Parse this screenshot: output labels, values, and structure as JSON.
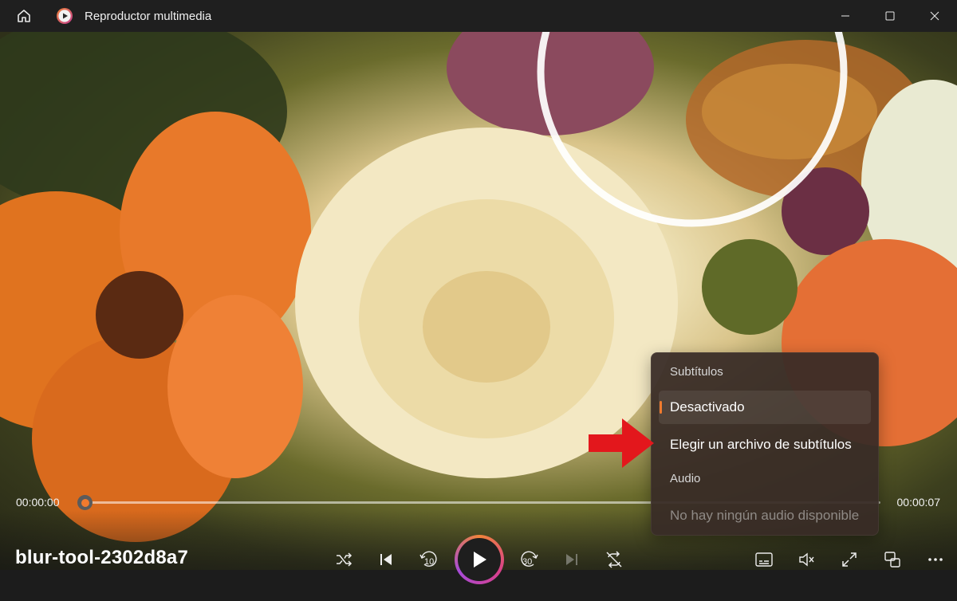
{
  "window": {
    "title": "Reproductor multimedia",
    "icons": {
      "home": "home-icon",
      "app": "media-player-logo-icon",
      "minimize": "minimize-icon",
      "maximize": "maximize-icon",
      "close": "close-icon"
    }
  },
  "player": {
    "media_title": "blur-tool-2302d8a7",
    "current_time": "00:00:00",
    "total_time": "00:00:07",
    "progress": 0.0,
    "controls": {
      "shuffle": "shuffle-icon",
      "previous": "previous-track-icon",
      "rewind": "rewind-10-icon",
      "rewind_label": "10",
      "play": "play-icon",
      "forward": "forward-30-icon",
      "forward_label": "30",
      "next": "next-track-icon",
      "repeat": "repeat-off-icon",
      "subtitles": "subtitles-icon",
      "volume": "volume-muted-icon",
      "fullscreen": "fullscreen-icon",
      "miniplayer": "miniplayer-icon",
      "more": "more-options-icon"
    }
  },
  "subtitle_menu": {
    "subtitles_heading": "Subtítulos",
    "options": [
      {
        "label": "Desactivado",
        "selected": true
      },
      {
        "label": "Elegir un archivo de subtítulos",
        "selected": false
      }
    ],
    "audio_heading": "Audio",
    "audio_empty": "No hay ningún audio disponible"
  },
  "colors": {
    "accent": "#f07a2e",
    "annotation_arrow": "#e3171c",
    "titlebar": "#1f1f1f",
    "menu_background": "#382c26"
  }
}
